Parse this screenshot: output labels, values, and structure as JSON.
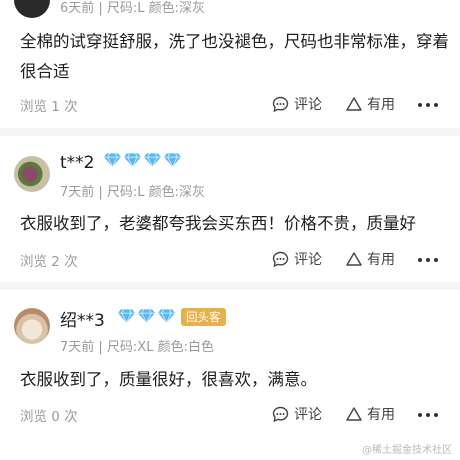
{
  "reviews": [
    {
      "username": "",
      "level_icon_count": 0,
      "badge": "",
      "meta": "6天前 | 尺码:L 颜色:深灰",
      "text": "全棉的试穿挺舒服，洗了也没褪色，尺码也非常标准，穿着很合适",
      "views": "浏览 1 次",
      "comment_label": "评论",
      "useful_label": "有用"
    },
    {
      "username": "t**2",
      "level_icon_count": 4,
      "badge": "",
      "meta": "7天前 | 尺码:L 颜色:深灰",
      "text": "衣服收到了，老婆都夸我会买东西！价格不贵，质量好",
      "views": "浏览 2 次",
      "comment_label": "评论",
      "useful_label": "有用"
    },
    {
      "username": "绍**3",
      "level_icon_count": 3,
      "badge": "回头客",
      "meta": "7天前 | 尺码:XL 颜色:白色",
      "text": "衣服收到了，质量很好，很喜欢，满意。",
      "views": "浏览 0 次",
      "comment_label": "评论",
      "useful_label": "有用"
    }
  ],
  "watermark": "@稀土掘金技术社区",
  "colors": {
    "diamond": "#5ab8f2",
    "badge": "#e8b04a",
    "meta": "#9a9a9a"
  },
  "icons": {
    "comment": "chat-bubble-icon",
    "useful": "triangle-icon",
    "more": "more-dots-icon",
    "level": "diamond-icon"
  }
}
